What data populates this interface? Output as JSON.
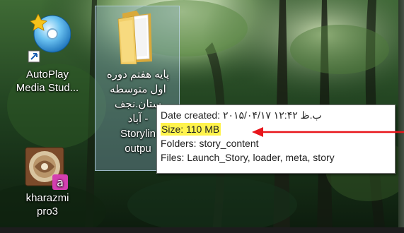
{
  "desktop": {
    "icons": [
      {
        "label": "AutoPlay\nMedia Stud...",
        "icon": "autoplay-cd-icon"
      },
      {
        "label": "پایه هفتم دوره\nاول متوسطه\nستان.نجف\n- آباد\nStorylin\noutpu",
        "icon": "folder-icon",
        "selected": true
      },
      {
        "label": "kharazmi\npro3",
        "icon": "kharazmi-app-icon"
      }
    ]
  },
  "tooltip": {
    "date_created": "Date created: ۲۰۱۵/۰۴/۱۷ ب.ظ ۱۲:۴۲",
    "size": "Size: 110 MB",
    "folders": "Folders: story_content",
    "files": "Files: Launch_Story, loader, meta, story"
  },
  "colors": {
    "highlight": "#fff34d",
    "arrow": "#e8151b",
    "selection": "#8cafcd"
  }
}
